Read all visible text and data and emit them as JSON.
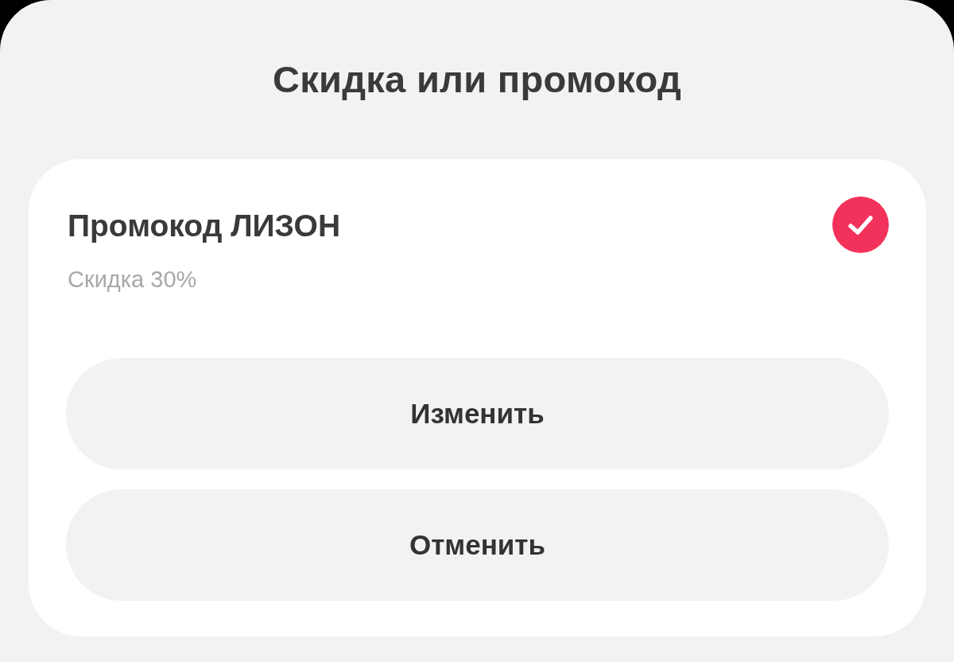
{
  "title": "Скидка или промокод",
  "promo": {
    "name": "Промокод ЛИЗОН",
    "description": "Скидка 30%",
    "selected": true
  },
  "buttons": [
    "Изменить",
    "Отменить"
  ]
}
